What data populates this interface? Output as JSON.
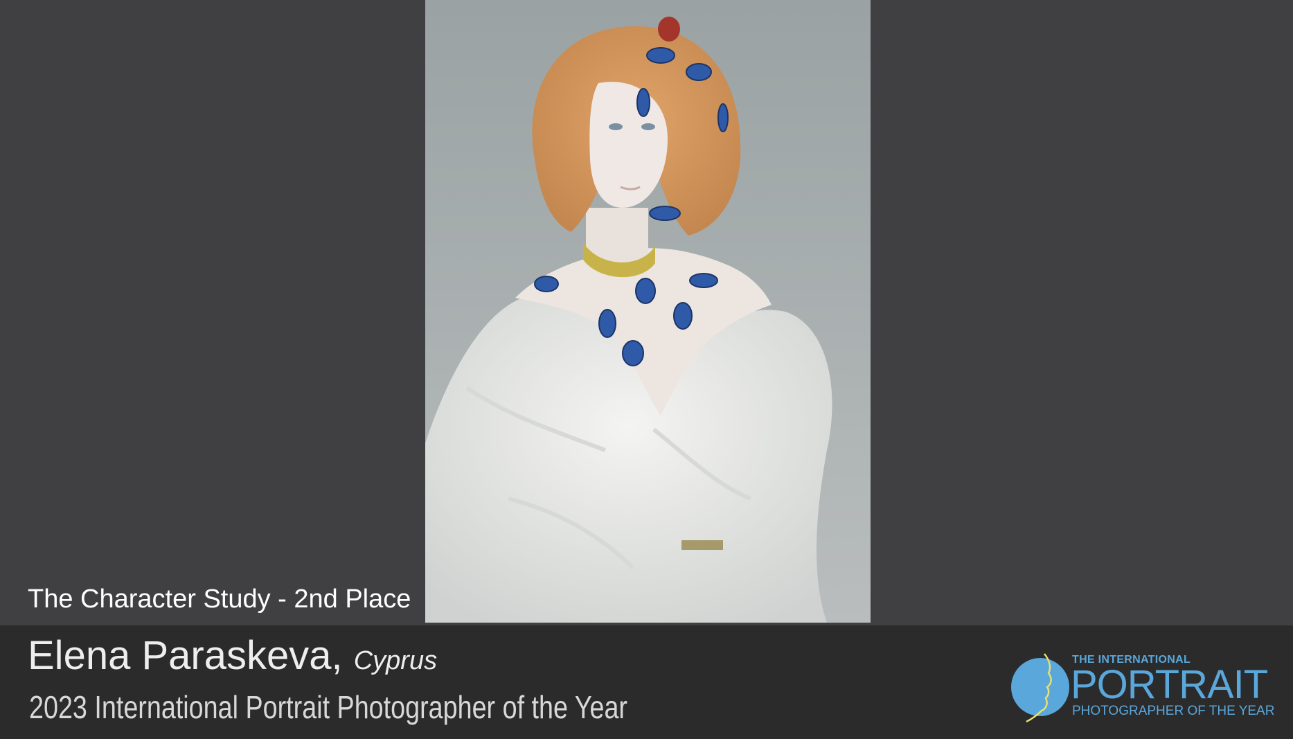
{
  "caption": {
    "category": "The Character Study - 2nd Place",
    "photographer": "Elena Paraskeva,",
    "country": "Cyprus",
    "award": "2023 International Portrait Photographer of the Year"
  },
  "logo": {
    "top": "THE INTERNATIONAL",
    "main": "PORTRAIT",
    "bottom": "PHOTOGRAPHER OF THE YEAR"
  },
  "colors": {
    "background": "#404042",
    "bottom_bar": "#2b2b2c",
    "logo_blue": "#5aa7db",
    "logo_profile_line": "#e8e070"
  }
}
